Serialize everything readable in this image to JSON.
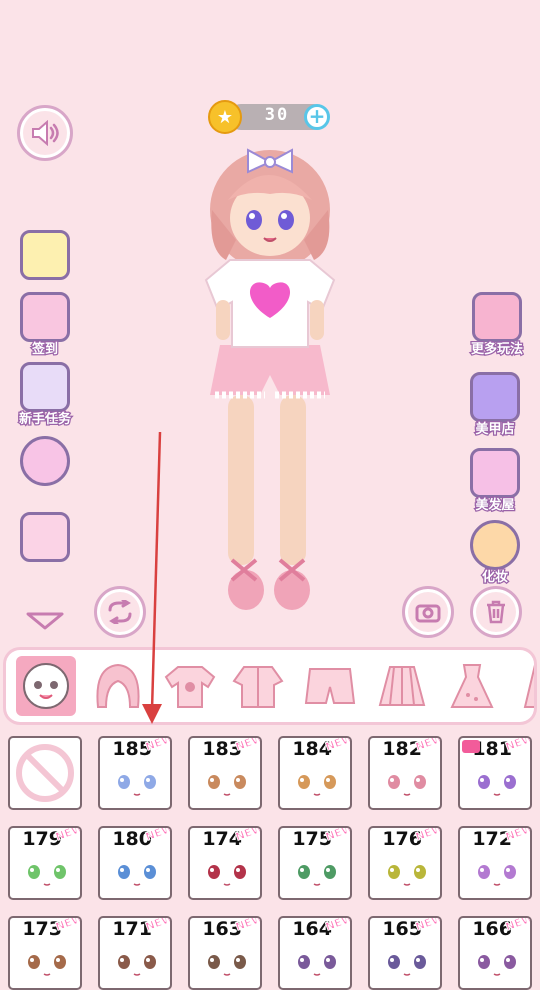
{
  "coins": {
    "value": "30"
  },
  "left_menu": [
    {
      "label": "",
      "icon": "cabinet-icon"
    },
    {
      "label": "签到",
      "icon": "calendar-icon"
    },
    {
      "label": "新手任务",
      "icon": "task-notebook-icon"
    },
    {
      "label": "",
      "icon": "friends-icon"
    },
    {
      "label": "",
      "icon": "wardrobe-icon"
    }
  ],
  "right_menu": [
    {
      "label": "更多玩法",
      "icon": "game-console-icon"
    },
    {
      "label": "美甲店",
      "icon": "nail-polish-icon"
    },
    {
      "label": "美发屋",
      "icon": "scissors-comb-icon"
    },
    {
      "label": "化妆",
      "icon": "palette-icon"
    }
  ],
  "categories": [
    "face-icon",
    "hair-icon",
    "tshirt-icon",
    "jacket-icon",
    "shorts-icon",
    "skirt-icon",
    "dress-icon",
    "sock-icon"
  ],
  "items": [
    {
      "num": "",
      "none": true
    },
    {
      "num": "185",
      "new": "NEW",
      "eye": "#8fa9e6"
    },
    {
      "num": "183",
      "new": "NEW",
      "eye": "#c98a5e"
    },
    {
      "num": "184",
      "new": "NEW",
      "eye": "#d6995a"
    },
    {
      "num": "182",
      "new": "NEW",
      "eye": "#e08ca2"
    },
    {
      "num": "181",
      "new": "NEW",
      "eye": "#9b6fd0",
      "video": true
    },
    {
      "num": "179",
      "new": "NEW",
      "eye": "#6fc46a"
    },
    {
      "num": "180",
      "new": "NEW",
      "eye": "#5b8fd6"
    },
    {
      "num": "174",
      "new": "NEW",
      "eye": "#b3334a"
    },
    {
      "num": "175",
      "new": "NEW",
      "eye": "#4e9b64"
    },
    {
      "num": "176",
      "new": "NEW",
      "eye": "#b9b63a"
    },
    {
      "num": "172",
      "new": "NEW",
      "eye": "#b37ad1"
    },
    {
      "num": "173",
      "new": "NEW",
      "eye": "#a56a4a"
    },
    {
      "num": "171",
      "new": "NEW",
      "eye": "#8a5a4a"
    },
    {
      "num": "163",
      "new": "NEW",
      "eye": "#7a5a4a"
    },
    {
      "num": "164",
      "new": "NEW",
      "eye": "#7a5a9a"
    },
    {
      "num": "165",
      "new": "NEW",
      "eye": "#6a5a9a"
    },
    {
      "num": "166",
      "new": "NEW",
      "eye": "#8a5aa0"
    }
  ],
  "colors": {
    "background": "#fbe3e8",
    "accent": "#f5a9c0",
    "arrow": "#d9403f"
  }
}
